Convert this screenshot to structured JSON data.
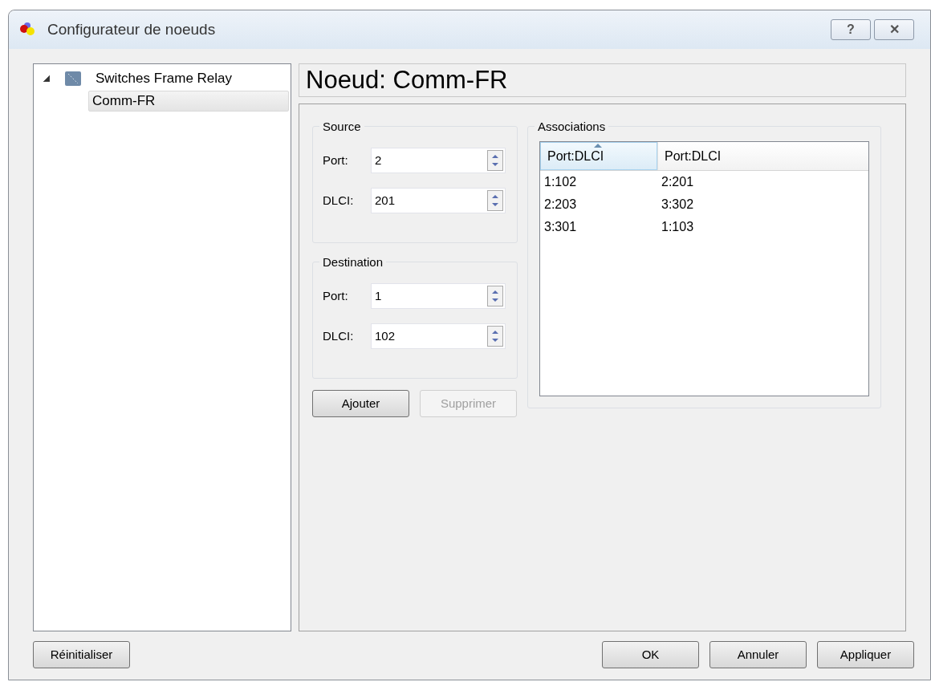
{
  "window": {
    "title": "Configurateur de noeuds",
    "buttons": [
      "?",
      "✕"
    ]
  },
  "tree": [
    {
      "label": "Switches Frame Relay",
      "expanded": true,
      "selected": false,
      "children": [
        {
          "label": "Comm-FR",
          "selected": true
        }
      ]
    }
  ],
  "header": "Noeud: Comm-FR",
  "groups": [
    {
      "title": "Source",
      "fields": [
        {
          "label": "Port:",
          "value": "2"
        },
        {
          "label": "DLCI:",
          "value": "201"
        }
      ]
    },
    {
      "title": "Destination",
      "fields": [
        {
          "label": "Port:",
          "value": "1"
        },
        {
          "label": "DLCI:",
          "value": "102"
        }
      ]
    }
  ],
  "actions": [
    {
      "label": "Ajouter",
      "disabled": false
    },
    {
      "label": "Supprimer",
      "disabled": true
    }
  ],
  "associations": {
    "title": "Associations",
    "columns": [
      {
        "label": "Port:DLCI",
        "sorted": true
      },
      {
        "label": "Port:DLCI",
        "sorted": false
      }
    ],
    "rows": [
      [
        "1:102",
        "2:201"
      ],
      [
        "2:203",
        "3:302"
      ],
      [
        "3:301",
        "1:103"
      ]
    ]
  },
  "footer_left": "Réinitialiser",
  "footer_buttons": [
    "OK",
    "Annuler",
    "Appliquer"
  ]
}
